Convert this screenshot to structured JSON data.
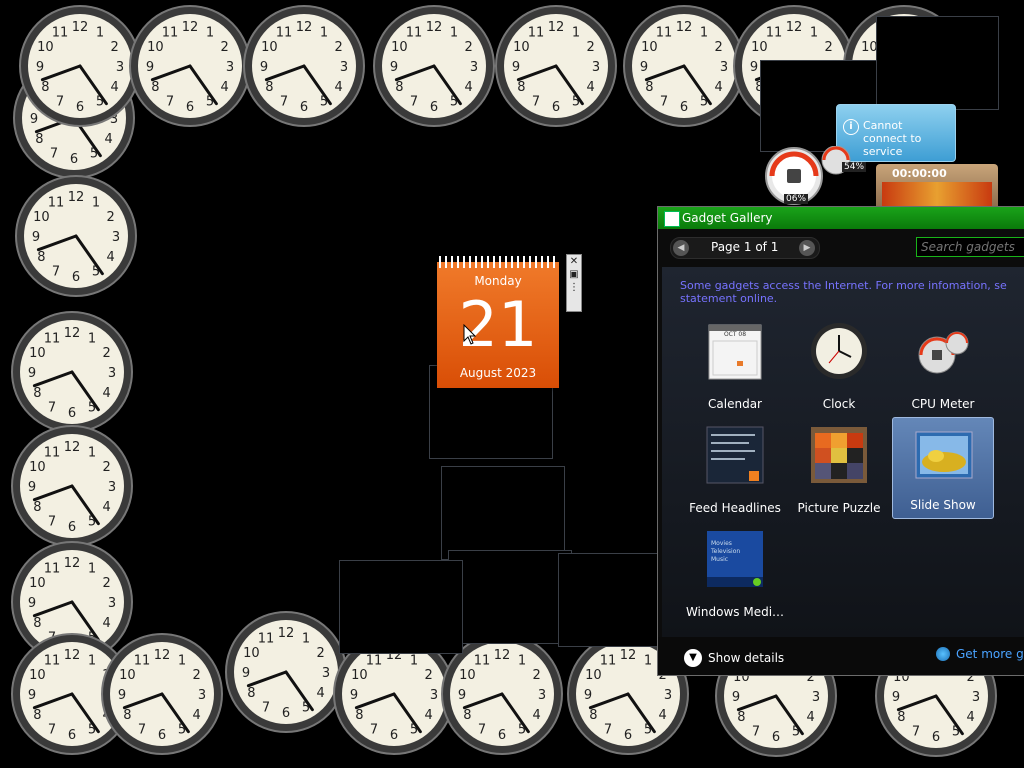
{
  "clocks": {
    "numerals": [
      "12",
      "1",
      "2",
      "3",
      "4",
      "5",
      "6",
      "7",
      "8",
      "9",
      "10",
      "11"
    ]
  },
  "notification": {
    "message": "Cannot connect to service"
  },
  "cpu_meter": {
    "cpu_percent": "06%",
    "memory_percent": "54%"
  },
  "calendar": {
    "day_name": "Monday",
    "day_number": "21",
    "month_year": "August 2023"
  },
  "gadget_controls": {
    "close": "✕",
    "options": "▣",
    "drag": "⋮"
  },
  "timer": {
    "time": "00:00:00"
  },
  "gallery": {
    "title": "Gadget Gallery",
    "page_label": "Page 1 of 1",
    "search_placeholder": "Search gadgets",
    "notice": "Some gadgets access the Internet.  For more infomation, se statement online.",
    "tiles": [
      {
        "label": "Calendar",
        "icon": "calendar-icon"
      },
      {
        "label": "Clock",
        "icon": "clock-icon"
      },
      {
        "label": "CPU Meter",
        "icon": "cpu-meter-icon"
      },
      {
        "label": "Feed Headlines",
        "icon": "feed-headlines-icon"
      },
      {
        "label": "Picture Puzzle",
        "icon": "picture-puzzle-icon"
      },
      {
        "label": "Slide Show",
        "icon": "slide-show-icon"
      },
      {
        "label": "Windows Medi…",
        "icon": "windows-media-center-icon"
      }
    ],
    "calendar_thumb_month": "OCT 08",
    "media_thumb_lines": [
      "Movies",
      "Television",
      "Music"
    ],
    "show_details": "Show details",
    "get_more": "Get more ga"
  }
}
